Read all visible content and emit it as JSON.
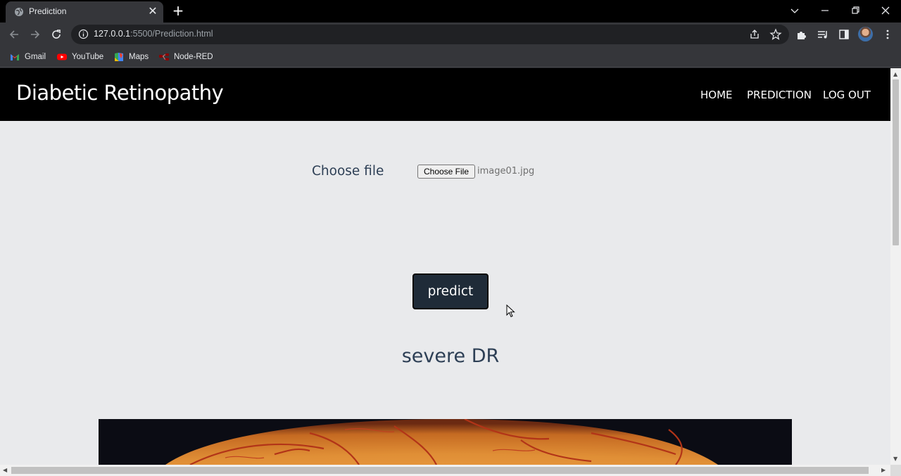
{
  "browser": {
    "tab_title": "Prediction",
    "url_host": "127.0.0.1",
    "url_rest": ":5500/Prediction.html",
    "bookmarks": [
      {
        "label": "Gmail",
        "icon": "gmail-icon"
      },
      {
        "label": "YouTube",
        "icon": "youtube-icon"
      },
      {
        "label": "Maps",
        "icon": "maps-icon"
      },
      {
        "label": "Node-RED",
        "icon": "node-red-icon"
      }
    ]
  },
  "site": {
    "brand": "Diabetic Retinopathy",
    "nav": [
      "HOME",
      "PREDICTION",
      "LOG OUT"
    ]
  },
  "form": {
    "file_label": "Choose file",
    "file_button": "Choose File",
    "file_name": "image01.jpg",
    "predict_label": "predict"
  },
  "result": {
    "text": "severe DR"
  },
  "colors": {
    "page_bg": "#e9eaec",
    "navbar_bg": "#000000",
    "button_bg": "#1f2b38",
    "text_dark": "#2d3f55"
  }
}
